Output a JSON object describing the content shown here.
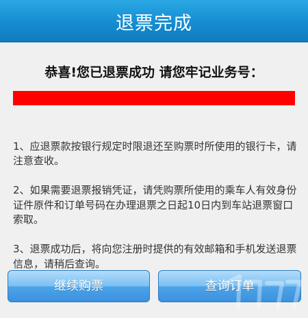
{
  "header": {
    "title": "退票完成"
  },
  "main": {
    "headline": "恭喜!您已退票成功 请您牢记业务号：",
    "redbar_color": "#ff0000",
    "notes": [
      "1、应退票款按银行规定时限退还至购票时所使用的银行卡，请注意查收。",
      "2、如果需要退票报销凭证，请凭购票所使用的乘车人有效身份证件原件和订单号码在办理退票之日起10日内到车站退票窗口索取。",
      "3、退票成功后，将向您注册时提供的有效邮箱和手机发送退票信息，请稍后查询。"
    ]
  },
  "buttons": {
    "continue_label": "继续购票",
    "query_label": "查询订单"
  }
}
